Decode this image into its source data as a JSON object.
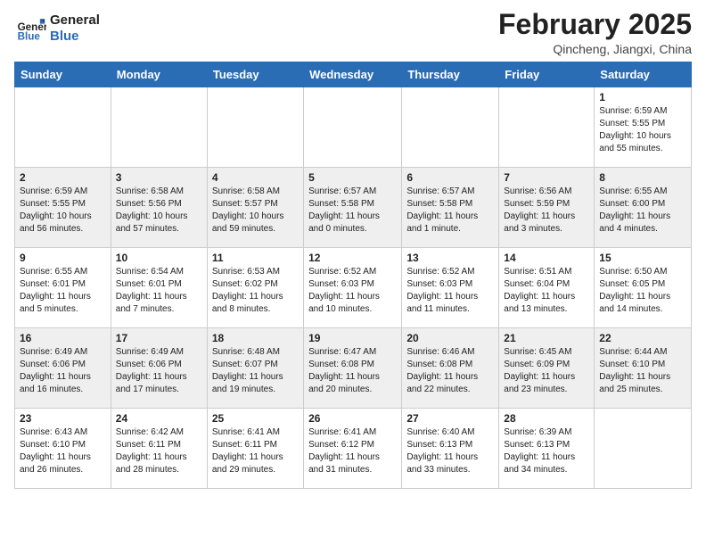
{
  "header": {
    "logo_line1": "General",
    "logo_line2": "Blue",
    "month": "February 2025",
    "location": "Qincheng, Jiangxi, China"
  },
  "weekdays": [
    "Sunday",
    "Monday",
    "Tuesday",
    "Wednesday",
    "Thursday",
    "Friday",
    "Saturday"
  ],
  "weeks": [
    [
      {
        "day": "",
        "info": ""
      },
      {
        "day": "",
        "info": ""
      },
      {
        "day": "",
        "info": ""
      },
      {
        "day": "",
        "info": ""
      },
      {
        "day": "",
        "info": ""
      },
      {
        "day": "",
        "info": ""
      },
      {
        "day": "1",
        "info": "Sunrise: 6:59 AM\nSunset: 5:55 PM\nDaylight: 10 hours\nand 55 minutes."
      }
    ],
    [
      {
        "day": "2",
        "info": "Sunrise: 6:59 AM\nSunset: 5:55 PM\nDaylight: 10 hours\nand 56 minutes."
      },
      {
        "day": "3",
        "info": "Sunrise: 6:58 AM\nSunset: 5:56 PM\nDaylight: 10 hours\nand 57 minutes."
      },
      {
        "day": "4",
        "info": "Sunrise: 6:58 AM\nSunset: 5:57 PM\nDaylight: 10 hours\nand 59 minutes."
      },
      {
        "day": "5",
        "info": "Sunrise: 6:57 AM\nSunset: 5:58 PM\nDaylight: 11 hours\nand 0 minutes."
      },
      {
        "day": "6",
        "info": "Sunrise: 6:57 AM\nSunset: 5:58 PM\nDaylight: 11 hours\nand 1 minute."
      },
      {
        "day": "7",
        "info": "Sunrise: 6:56 AM\nSunset: 5:59 PM\nDaylight: 11 hours\nand 3 minutes."
      },
      {
        "day": "8",
        "info": "Sunrise: 6:55 AM\nSunset: 6:00 PM\nDaylight: 11 hours\nand 4 minutes."
      }
    ],
    [
      {
        "day": "9",
        "info": "Sunrise: 6:55 AM\nSunset: 6:01 PM\nDaylight: 11 hours\nand 5 minutes."
      },
      {
        "day": "10",
        "info": "Sunrise: 6:54 AM\nSunset: 6:01 PM\nDaylight: 11 hours\nand 7 minutes."
      },
      {
        "day": "11",
        "info": "Sunrise: 6:53 AM\nSunset: 6:02 PM\nDaylight: 11 hours\nand 8 minutes."
      },
      {
        "day": "12",
        "info": "Sunrise: 6:52 AM\nSunset: 6:03 PM\nDaylight: 11 hours\nand 10 minutes."
      },
      {
        "day": "13",
        "info": "Sunrise: 6:52 AM\nSunset: 6:03 PM\nDaylight: 11 hours\nand 11 minutes."
      },
      {
        "day": "14",
        "info": "Sunrise: 6:51 AM\nSunset: 6:04 PM\nDaylight: 11 hours\nand 13 minutes."
      },
      {
        "day": "15",
        "info": "Sunrise: 6:50 AM\nSunset: 6:05 PM\nDaylight: 11 hours\nand 14 minutes."
      }
    ],
    [
      {
        "day": "16",
        "info": "Sunrise: 6:49 AM\nSunset: 6:06 PM\nDaylight: 11 hours\nand 16 minutes."
      },
      {
        "day": "17",
        "info": "Sunrise: 6:49 AM\nSunset: 6:06 PM\nDaylight: 11 hours\nand 17 minutes."
      },
      {
        "day": "18",
        "info": "Sunrise: 6:48 AM\nSunset: 6:07 PM\nDaylight: 11 hours\nand 19 minutes."
      },
      {
        "day": "19",
        "info": "Sunrise: 6:47 AM\nSunset: 6:08 PM\nDaylight: 11 hours\nand 20 minutes."
      },
      {
        "day": "20",
        "info": "Sunrise: 6:46 AM\nSunset: 6:08 PM\nDaylight: 11 hours\nand 22 minutes."
      },
      {
        "day": "21",
        "info": "Sunrise: 6:45 AM\nSunset: 6:09 PM\nDaylight: 11 hours\nand 23 minutes."
      },
      {
        "day": "22",
        "info": "Sunrise: 6:44 AM\nSunset: 6:10 PM\nDaylight: 11 hours\nand 25 minutes."
      }
    ],
    [
      {
        "day": "23",
        "info": "Sunrise: 6:43 AM\nSunset: 6:10 PM\nDaylight: 11 hours\nand 26 minutes."
      },
      {
        "day": "24",
        "info": "Sunrise: 6:42 AM\nSunset: 6:11 PM\nDaylight: 11 hours\nand 28 minutes."
      },
      {
        "day": "25",
        "info": "Sunrise: 6:41 AM\nSunset: 6:11 PM\nDaylight: 11 hours\nand 29 minutes."
      },
      {
        "day": "26",
        "info": "Sunrise: 6:41 AM\nSunset: 6:12 PM\nDaylight: 11 hours\nand 31 minutes."
      },
      {
        "day": "27",
        "info": "Sunrise: 6:40 AM\nSunset: 6:13 PM\nDaylight: 11 hours\nand 33 minutes."
      },
      {
        "day": "28",
        "info": "Sunrise: 6:39 AM\nSunset: 6:13 PM\nDaylight: 11 hours\nand 34 minutes."
      },
      {
        "day": "",
        "info": ""
      }
    ]
  ]
}
